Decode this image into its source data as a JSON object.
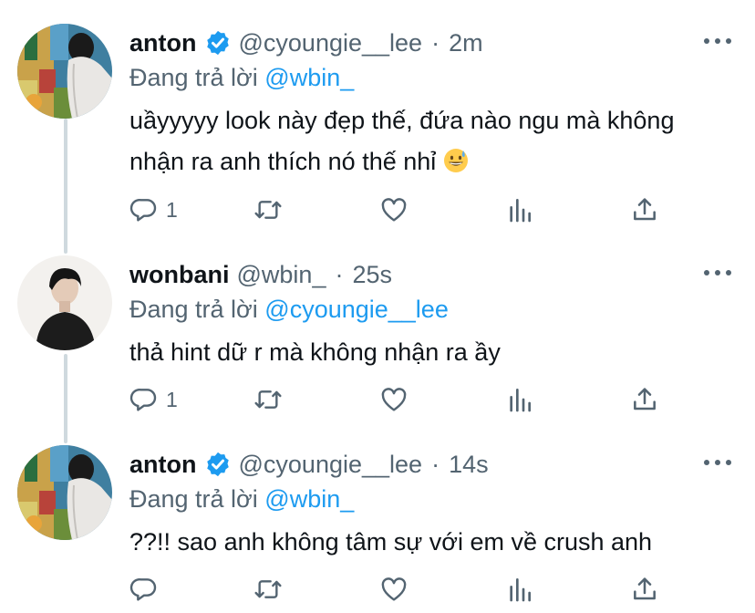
{
  "tweets": [
    {
      "name": "anton",
      "verified": true,
      "handle": "@cyoungie__lee",
      "time": "2m",
      "reply_prefix": "Đang trả lời",
      "reply_to": "@wbin_",
      "text_line1": "uầyyyyy look này đẹp thế, đứa nào ngu mà không",
      "text_line2": "nhận ra anh thích nó thế nhỉ",
      "emoji": "grinning-sweat-emoji",
      "reply_count": "1"
    },
    {
      "name": "wonbani",
      "verified": false,
      "handle": "@wbin_",
      "time": "25s",
      "reply_prefix": "Đang trả lời",
      "reply_to": "@cyoungie__lee",
      "text_line1": "thả hint dữ r mà không nhận ra ầy",
      "reply_count": "1"
    },
    {
      "name": "anton",
      "verified": true,
      "handle": "@cyoungie__lee",
      "time": "14s",
      "reply_prefix": "Đang trả lời",
      "reply_to": "@wbin_",
      "text_line1": "??!! sao anh không tâm sự với em về crush anh",
      "reply_count": ""
    }
  ],
  "separator": "·",
  "colors": {
    "text": "#0f1419",
    "secondary": "#536471",
    "accent": "#1d9bf0",
    "thread_line": "#cfd9de"
  },
  "icons": [
    "reply-icon",
    "retweet-icon",
    "like-icon",
    "analytics-icon",
    "share-icon",
    "more-icon",
    "verified-icon"
  ]
}
